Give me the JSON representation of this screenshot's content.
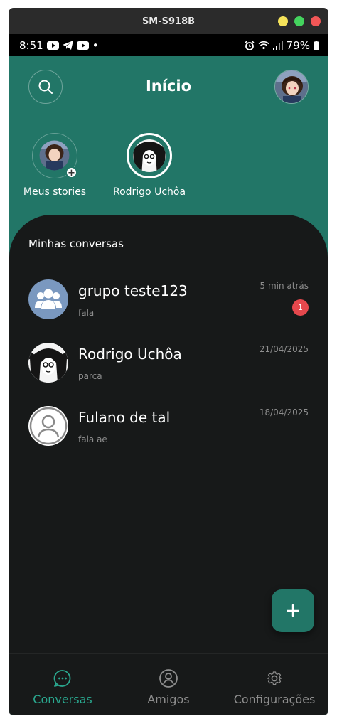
{
  "window": {
    "title": "SM-S918B",
    "dot_colors": [
      "#f5e35a",
      "#44d35e",
      "#f25757"
    ]
  },
  "statusbar": {
    "time": "8:51",
    "dot": "•",
    "battery": "79%"
  },
  "header": {
    "title": "Início",
    "search_icon": "search-icon"
  },
  "stories": [
    {
      "label": "Meus stories",
      "plus": "+"
    },
    {
      "label": "Rodrigo Uchôa"
    }
  ],
  "conversations": {
    "title": "Minhas conversas",
    "items": [
      {
        "name": "grupo teste123",
        "message": "fala",
        "time": "5 min atrás",
        "unread": "1",
        "avatar": "group-icon"
      },
      {
        "name": "Rodrigo Uchôa",
        "message": "parca",
        "time": "21/04/2025",
        "avatar": "user-photo"
      },
      {
        "name": "Fulano de tal",
        "message": "fala ae",
        "time": "18/04/2025",
        "avatar": "person-icon"
      }
    ]
  },
  "fab": {
    "icon": "plus-icon",
    "label": "+"
  },
  "nav": [
    {
      "label": "Conversas",
      "icon": "chat-icon",
      "active": true
    },
    {
      "label": "Amigos",
      "icon": "person-circle-icon"
    },
    {
      "label": "Configurações",
      "icon": "gear-icon"
    }
  ],
  "colors": {
    "accent": "#227667",
    "accent_text": "#2aa88f",
    "background": "#171919",
    "badge": "#e5484d"
  }
}
